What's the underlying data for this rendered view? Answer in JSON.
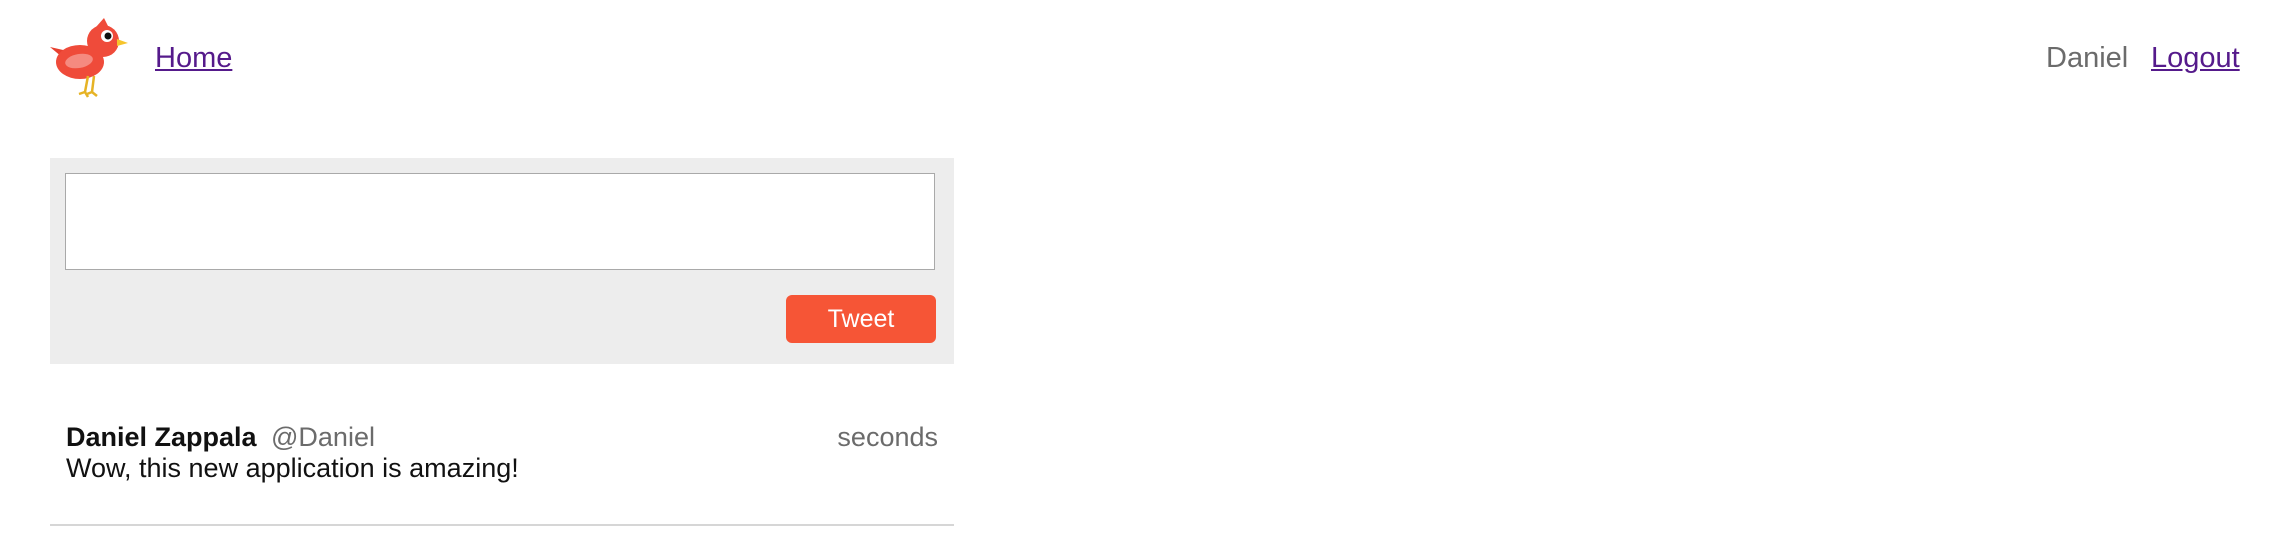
{
  "header": {
    "logo_icon": "red-bird-logo-icon",
    "home_label": "Home",
    "user_name": "Daniel",
    "logout_label": "Logout"
  },
  "compose": {
    "input_value": "",
    "input_placeholder": "",
    "tweet_button_label": "Tweet",
    "button_color": "#f65536",
    "panel_color": "#ededed"
  },
  "tweets": [
    {
      "author": "Daniel Zappala",
      "handle": "@Daniel",
      "time": "seconds",
      "text": "Wow, this new application is amazing!"
    }
  ],
  "colors": {
    "link": "#551a8b",
    "muted_text": "#6b6b6b",
    "divider": "#d6d6d6"
  }
}
